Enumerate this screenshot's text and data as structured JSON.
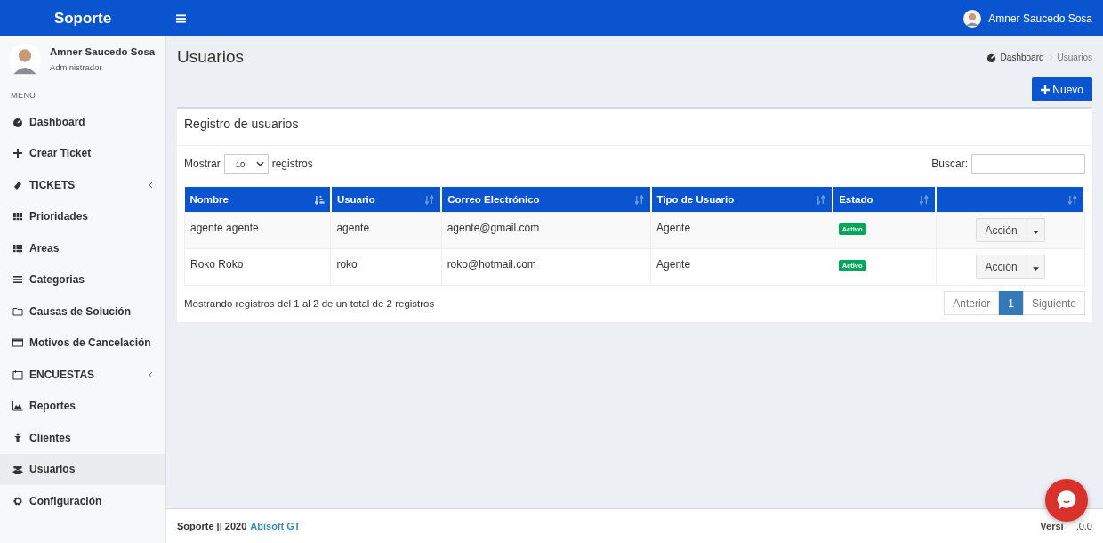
{
  "header": {
    "brand": "Soporte",
    "user_name": "Amner Saucedo Sosa"
  },
  "sidebar": {
    "user": {
      "name": "Amner Saucedo Sosa",
      "role": "Administrador"
    },
    "menu_heading": "MENU",
    "items": [
      {
        "label": "Dashboard",
        "selected": false,
        "submenu": false
      },
      {
        "label": "Crear Ticket",
        "selected": false,
        "submenu": false
      },
      {
        "label": "TICKETS",
        "selected": false,
        "submenu": true
      },
      {
        "label": "Prioridades",
        "selected": false,
        "submenu": false
      },
      {
        "label": "Areas",
        "selected": false,
        "submenu": false
      },
      {
        "label": "Categorias",
        "selected": false,
        "submenu": false
      },
      {
        "label": "Causas de Solución",
        "selected": false,
        "submenu": false
      },
      {
        "label": "Motivos de Cancelación",
        "selected": false,
        "submenu": false
      },
      {
        "label": "ENCUESTAS",
        "selected": false,
        "submenu": true
      },
      {
        "label": "Reportes",
        "selected": false,
        "submenu": false
      },
      {
        "label": "Clientes",
        "selected": false,
        "submenu": false
      },
      {
        "label": "Usuarios",
        "selected": true,
        "submenu": false
      },
      {
        "label": "Configuración",
        "selected": false,
        "submenu": false
      }
    ]
  },
  "page": {
    "title": "Usuarios",
    "breadcrumb": [
      "Dashboard",
      "Usuarios"
    ],
    "new_button": "Nuevo"
  },
  "card": {
    "title": "Registro de usuarios",
    "show_label": "Mostrar",
    "page_size": "10",
    "show_suffix": "registros",
    "search_label": "Buscar:",
    "table": {
      "columns": [
        {
          "label": "Nombre",
          "sorted": true
        },
        {
          "label": "Usuario",
          "sorted": false
        },
        {
          "label": "Correo Electrónico",
          "sorted": false
        },
        {
          "label": "Tipo de Usuario",
          "sorted": false
        },
        {
          "label": "Estado",
          "sorted": false
        },
        {
          "sorted": false
        }
      ],
      "rows": [
        {
          "cells": [
            "agente agente",
            "agente",
            "agente@gmail.com",
            "Agente"
          ],
          "status": "Activo",
          "action": "Acción"
        },
        {
          "cells": [
            "Roko Roko",
            "roko",
            "roko@hotmail.com",
            "Agente"
          ],
          "status": "Activo",
          "action": "Acción"
        }
      ]
    },
    "info": "Mostrando registros del 1 al 2 de un total de 2 registros",
    "pagination": [
      {
        "label": "Anterior",
        "selected": false
      },
      {
        "label": "1",
        "selected": true
      },
      {
        "label": "Siguiente",
        "selected": false
      }
    ]
  },
  "footer": {
    "app": "Soporte || 2020",
    "company": "Abisoft GT",
    "version": "Versi",
    "version_tail": ".0.0"
  }
}
